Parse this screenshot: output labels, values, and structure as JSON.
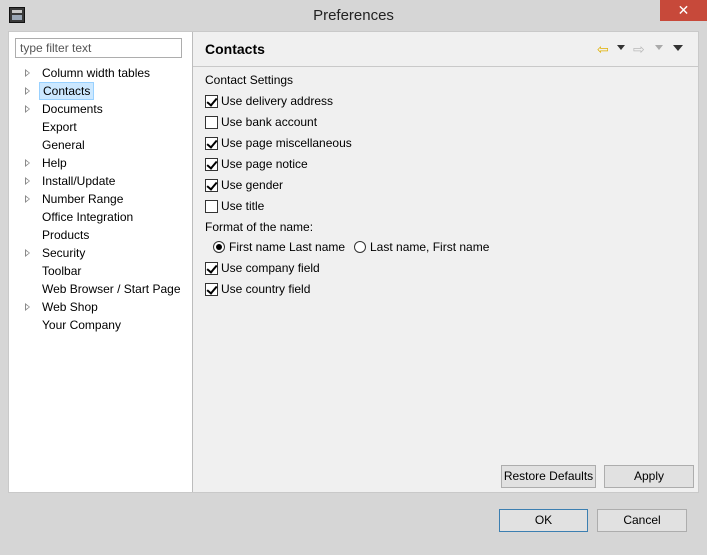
{
  "window": {
    "title": "Preferences",
    "close_glyph": "✕"
  },
  "sidebar": {
    "filter_placeholder": "type filter text",
    "items": [
      {
        "label": "Column width tables",
        "expandable": true,
        "selected": false
      },
      {
        "label": "Contacts",
        "expandable": true,
        "selected": true
      },
      {
        "label": "Documents",
        "expandable": true,
        "selected": false
      },
      {
        "label": "Export",
        "expandable": false,
        "selected": false
      },
      {
        "label": "General",
        "expandable": false,
        "selected": false
      },
      {
        "label": "Help",
        "expandable": true,
        "selected": false
      },
      {
        "label": "Install/Update",
        "expandable": true,
        "selected": false
      },
      {
        "label": "Number Range",
        "expandable": true,
        "selected": false
      },
      {
        "label": "Office Integration",
        "expandable": false,
        "selected": false
      },
      {
        "label": "Products",
        "expandable": false,
        "selected": false
      },
      {
        "label": "Security",
        "expandable": true,
        "selected": false
      },
      {
        "label": "Toolbar",
        "expandable": false,
        "selected": false
      },
      {
        "label": "Web Browser / Start Page",
        "expandable": false,
        "selected": false
      },
      {
        "label": "Web Shop",
        "expandable": true,
        "selected": false
      },
      {
        "label": "Your Company",
        "expandable": false,
        "selected": false
      }
    ]
  },
  "main": {
    "title": "Contacts",
    "section_label": "Contact Settings",
    "options_top": [
      {
        "label": "Use delivery address",
        "checked": true
      },
      {
        "label": "Use bank account",
        "checked": false
      },
      {
        "label": "Use page miscellaneous",
        "checked": true
      },
      {
        "label": "Use page notice",
        "checked": true
      },
      {
        "label": "Use gender",
        "checked": true
      },
      {
        "label": "Use title",
        "checked": false
      }
    ],
    "name_format_label": "Format of the name:",
    "name_format_options": [
      {
        "label": "First name Last name",
        "selected": true
      },
      {
        "label": "Last name, First name",
        "selected": false
      }
    ],
    "options_bottom": [
      {
        "label": "Use company field",
        "checked": true
      },
      {
        "label": "Use country field",
        "checked": true
      }
    ],
    "restore_defaults_label": "Restore Defaults",
    "apply_label": "Apply"
  },
  "footer": {
    "ok_label": "OK",
    "cancel_label": "Cancel"
  },
  "colors": {
    "selection": "#cce8ff",
    "close": "#c7493a",
    "back_arrow": "#e8b800"
  }
}
